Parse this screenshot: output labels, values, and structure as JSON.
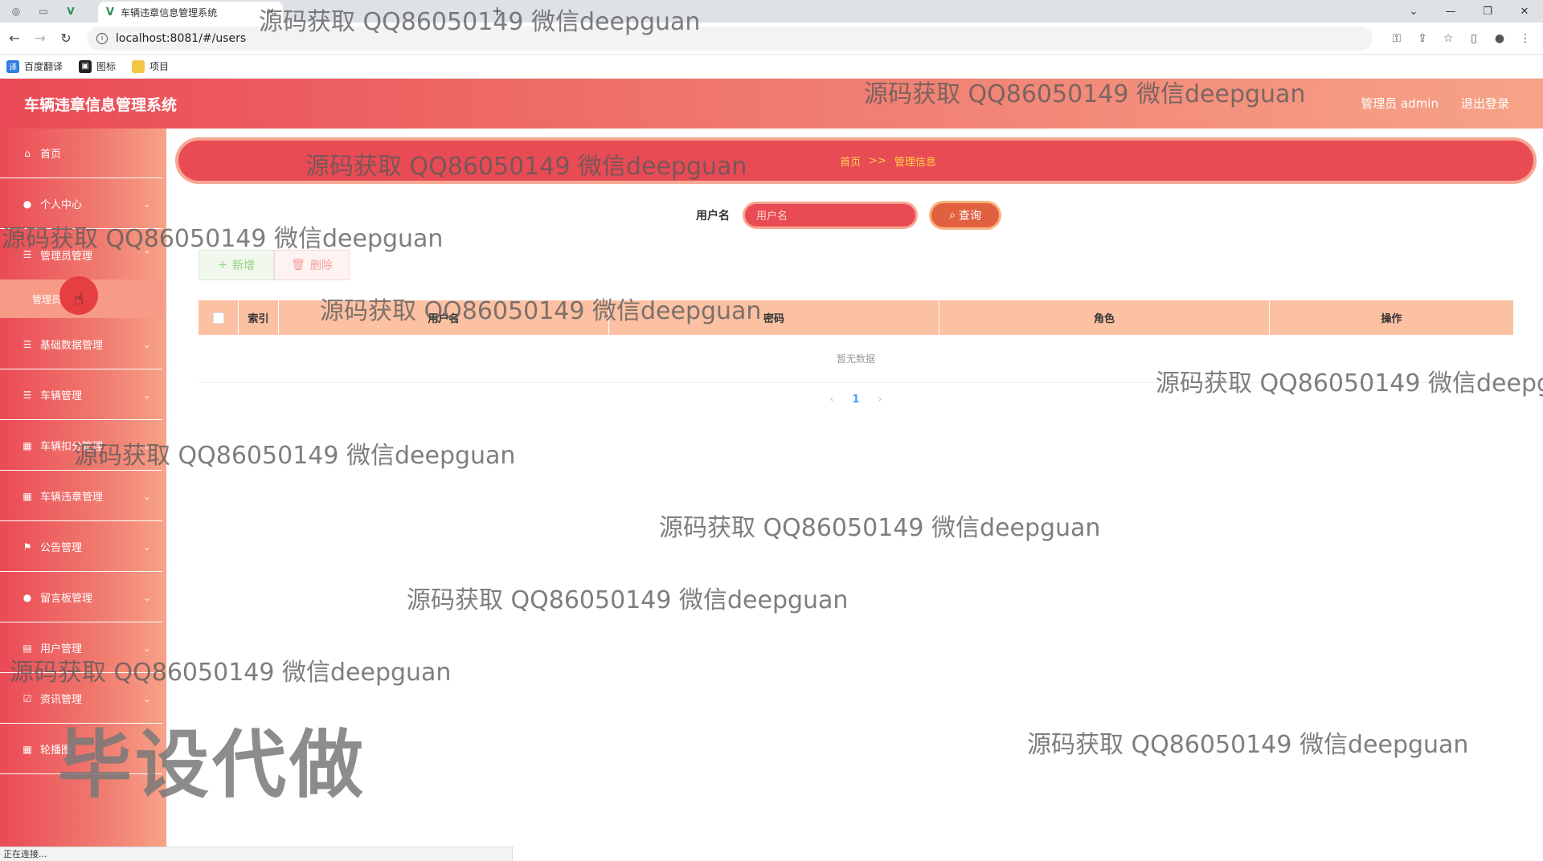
{
  "browser": {
    "tab_title": "车辆违章信息管理系统",
    "url": "localhost:8081/#/users",
    "bookmarks": [
      "百度翻译",
      "图标",
      "项目"
    ]
  },
  "header": {
    "title": "车辆违章信息管理系统",
    "user_label": "管理员 admin",
    "logout_label": "退出登录"
  },
  "sidebar": {
    "items": [
      {
        "label": "首页",
        "icon": "home-icon"
      },
      {
        "label": "个人中心",
        "icon": "person-icon"
      },
      {
        "label": "管理员管理",
        "icon": "sliders-icon"
      },
      {
        "label": "基础数据管理",
        "icon": "list-icon"
      },
      {
        "label": "车辆管理",
        "icon": "list-icon"
      },
      {
        "label": "车辆扣分管理",
        "icon": "grid-icon"
      },
      {
        "label": "车辆违章管理",
        "icon": "grid-icon"
      },
      {
        "label": "公告管理",
        "icon": "flag-icon"
      },
      {
        "label": "留言板管理",
        "icon": "person-icon"
      },
      {
        "label": "用户管理",
        "icon": "clipboard-icon"
      },
      {
        "label": "资讯管理",
        "icon": "checkbox-icon"
      },
      {
        "label": "轮播图",
        "icon": "grid-icon"
      }
    ],
    "submenu_label": "管理员"
  },
  "breadcrumb": {
    "home": "首页",
    "separator": ">>",
    "current": "管理信息"
  },
  "search": {
    "label": "用户名",
    "placeholder": "用户名",
    "button_label": "查询"
  },
  "toolbar": {
    "add_label": "新增",
    "delete_label": "删除"
  },
  "table": {
    "columns": [
      "索引",
      "用户名",
      "密码",
      "角色",
      "操作"
    ],
    "empty_text": "暂无数据"
  },
  "pagination": {
    "current_page": "1"
  },
  "statusbar": {
    "text": "正在连接..."
  },
  "watermarks": {
    "line": "源码获取 QQ86050149 微信deepguan",
    "line_cut": "源码获取 QQ86050149 微信deepg",
    "big": "毕设代做"
  },
  "colors": {
    "primary_red": "#e94b55",
    "accent_peach": "#f7a388",
    "breadcrumb_text": "#ffd24a",
    "table_header": "#fcc1a3"
  }
}
